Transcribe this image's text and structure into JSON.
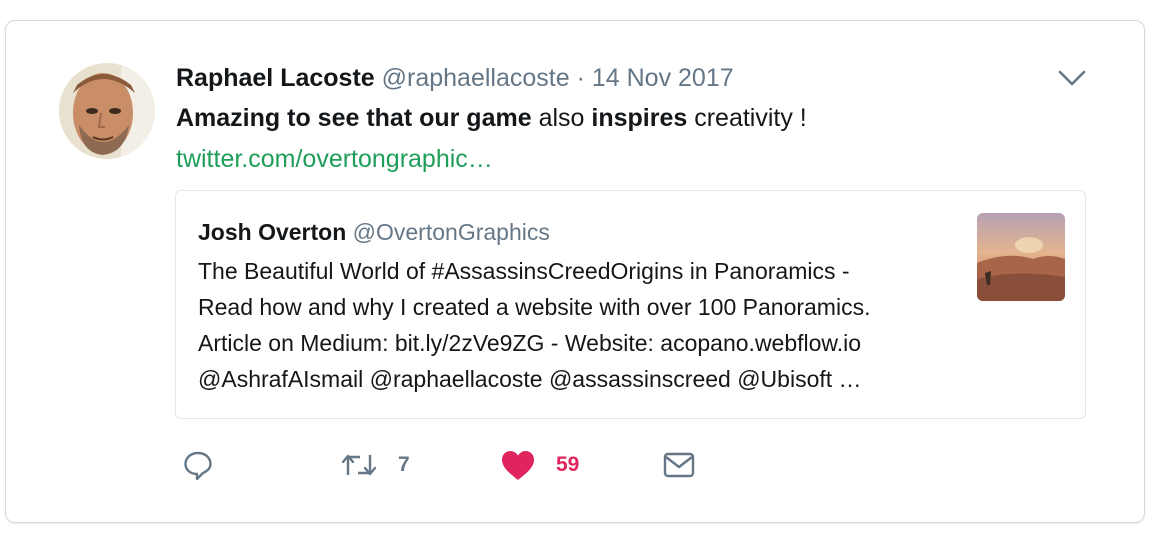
{
  "tweet": {
    "author_name": "Raphael Lacoste",
    "author_handle": "@raphaellacoste",
    "separator": "·",
    "date": "14 Nov 2017",
    "text_segments": [
      {
        "text": "Amazing to see that our game",
        "bold": true
      },
      {
        "text": " also ",
        "bold": false
      },
      {
        "text": "inspires",
        "bold": true
      },
      {
        "text": " creativity !",
        "bold": false
      }
    ],
    "link": "twitter.com/overtongraphic…",
    "caret_icon": "chevron-down-icon"
  },
  "quoted": {
    "author_name": "Josh Overton",
    "author_handle": "@OvertonGraphics",
    "lines": [
      "The Beautiful World of #AssassinsCreedOrigins in Panoramics -",
      "Read how and why I created a website with over 100 Panoramics.",
      "Article on Medium: bit.ly/2zVe9ZG - Website: acopano.webflow.io",
      "@AshrafAIsmail @raphaellacoste @assassinscreed @Ubisoft …"
    ]
  },
  "actions": {
    "reply": {
      "icon": "reply-icon"
    },
    "retweet": {
      "icon": "retweet-icon",
      "count": "7"
    },
    "like": {
      "icon": "heart-icon",
      "count": "59",
      "color": "#e0245e",
      "liked": true
    },
    "dm": {
      "icon": "envelope-icon"
    }
  },
  "colors": {
    "link": "#1f9e5a",
    "secondary_text": "#657786",
    "border": "#d4d9de",
    "like": "#e0245e"
  }
}
